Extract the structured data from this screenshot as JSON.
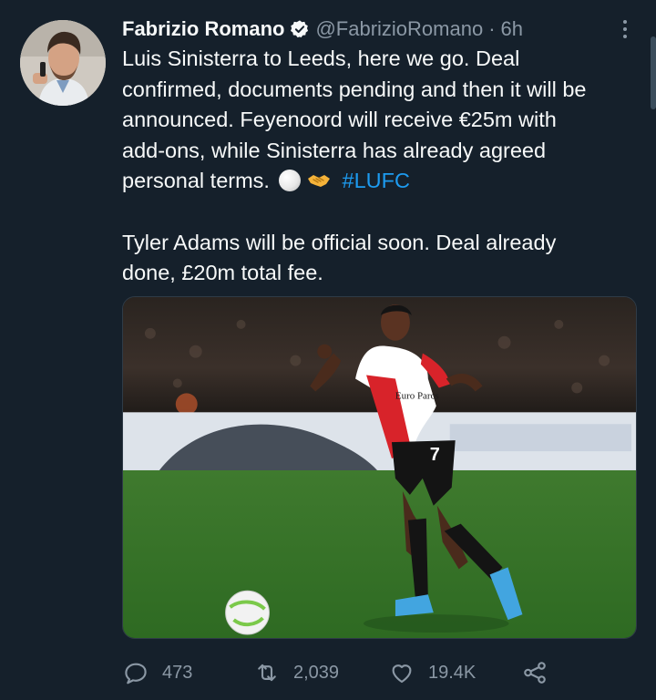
{
  "tweet": {
    "author_name": "Fabrizio Romano",
    "handle": "@FabrizioRomano",
    "separator": "·",
    "time": "6h",
    "lines_para1": [
      "Luis Sinisterra to Leeds, here we go. Deal",
      "confirmed, documents pending and then it will be",
      "announced. Feyenoord will receive €25m with",
      "add-ons, while Sinisterra has already agreed",
      "personal terms."
    ],
    "hashtag": "#LUFC",
    "lines_para2": [
      "Tyler Adams will be official soon. Deal already",
      "done, £20m total fee."
    ],
    "media_text": {
      "shirt_sponsor": "Euro Parcs",
      "shirt_number": "7"
    }
  },
  "actions": {
    "reply_count": "473",
    "retweet_count": "2,039",
    "like_count": "19.4K"
  },
  "colors": {
    "background": "#15202b",
    "accent": "#1d9bf0",
    "muted": "#8b98a5"
  },
  "icons": [
    "verified-badge-icon",
    "more-icon",
    "soccer-ball-emoji",
    "handshake-emoji",
    "reply-icon",
    "retweet-icon",
    "like-icon",
    "share-icon"
  ]
}
